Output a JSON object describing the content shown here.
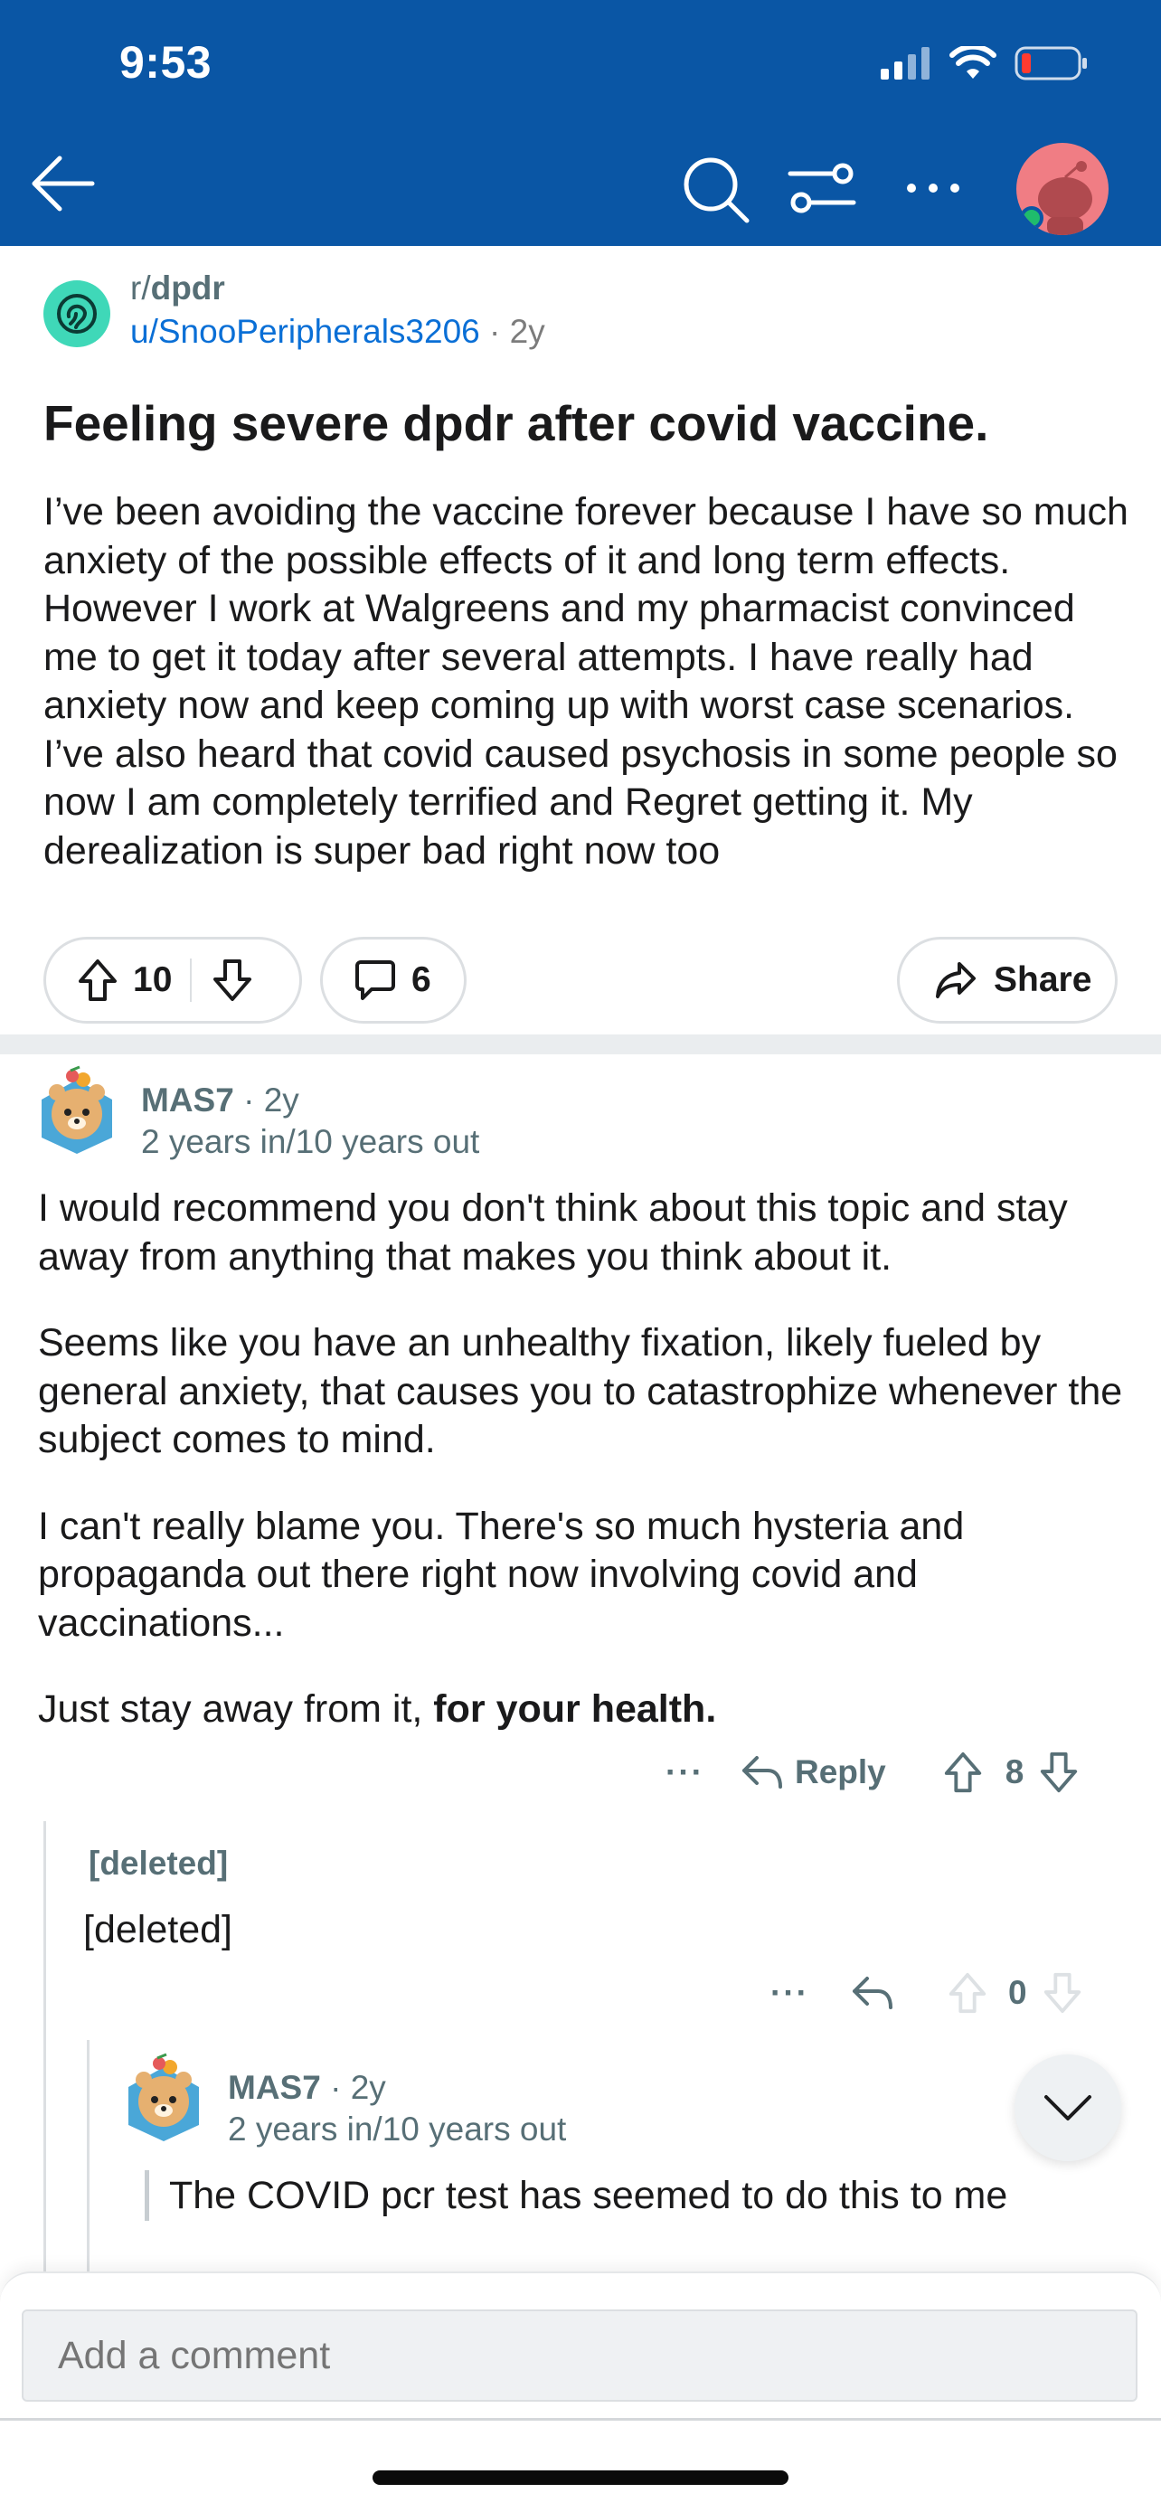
{
  "status_bar": {
    "time": "9:53"
  },
  "header": {
    "back_label": "back",
    "search_label": "search",
    "filter_label": "sort",
    "more_label": "more"
  },
  "post": {
    "subreddit_prefix": "r/",
    "subreddit": "dpdr",
    "author": "u/SnooPeripherals3206",
    "age": "2y",
    "title": "Feeling severe dpdr after covid vaccine.",
    "body": "I’ve been avoiding the vaccine forever because I have so much anxiety of the possible effects of it and long term effects. However I work at Walgreens and my pharmacist convinced me to get it today after several attempts. I have really had anxiety now and keep coming up with worst case scenarios. I’ve also heard that covid caused psychosis in some people so now I am completely terrified and Regret getting it. My derealization is super bad right now too",
    "votes": "10",
    "comments": "6",
    "share_label": "Share"
  },
  "comments": [
    {
      "author": "MAS7",
      "age": "2y",
      "flair": "2 years in/10 years out",
      "paragraphs": [
        "I would recommend you don't think about this topic and stay away from anything that makes you think about it.",
        "Seems like you have an unhealthy fixation, likely fueled by general anxiety, that causes you to catastrophize whenever the subject comes to mind.",
        "I can't really blame you. There's so much hysteria and propaganda out there right now involving covid and vaccinations..."
      ],
      "last_paragraph_plain": "Just stay away from it, ",
      "last_paragraph_bold": "for your health.",
      "more": "···",
      "reply_label": "Reply",
      "votes": "8"
    },
    {
      "author": "[deleted]",
      "body": "[deleted]",
      "more": "···",
      "votes": "0"
    },
    {
      "author": "MAS7",
      "age": "2y",
      "flair": "2 years in/10 years out",
      "quote": "The COVID pcr test has seemed to do this to me"
    }
  ],
  "composer": {
    "placeholder": "Add a comment"
  },
  "colors": {
    "header_bg": "#0a56a5",
    "link": "#0a6fd6",
    "muted": "#576f76",
    "online": "#1fbc6c"
  }
}
